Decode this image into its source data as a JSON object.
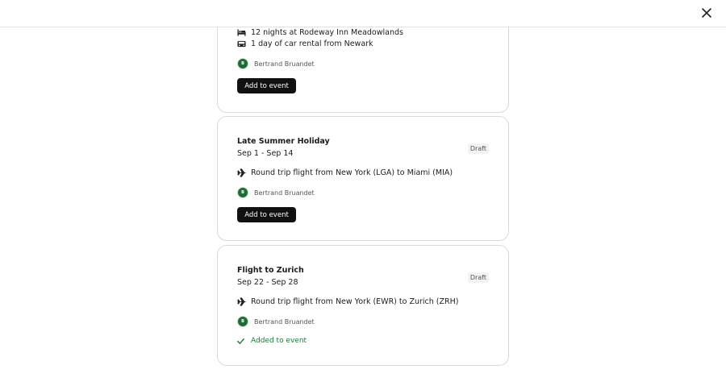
{
  "header": {
    "close_label": "×"
  },
  "cards": [
    {
      "items": [
        {
          "icon": "bed-icon",
          "text": "12 nights at Rodeway Inn Meadowlands"
        },
        {
          "icon": "car-icon",
          "text": "1 day of car rental from Newark"
        }
      ],
      "owner": {
        "initial": "B",
        "name": "Bertrand Bruandet"
      },
      "action_label": "Add to event"
    },
    {
      "title": "Late Summer Holiday",
      "dates": "Sep 1 - Sep 14",
      "status": "Draft",
      "items": [
        {
          "icon": "plane-icon",
          "text": "Round trip flight from New York (LGA) to Miami (MIA)"
        }
      ],
      "owner": {
        "initial": "B",
        "name": "Bertrand Bruandet"
      },
      "action_label": "Add to event"
    },
    {
      "title": "Flight to Zurich",
      "dates": "Sep 22 - Sep 28",
      "status": "Draft",
      "items": [
        {
          "icon": "plane-icon",
          "text": "Round trip flight from New York (EWR) to Zurich (ZRH)"
        }
      ],
      "owner": {
        "initial": "B",
        "name": "Bertrand Bruandet"
      },
      "added_label": "Added to event"
    }
  ],
  "colors": {
    "added_green": "#1d7a3a",
    "avatar_green": "#1f6b39",
    "button_black": "#111111"
  }
}
